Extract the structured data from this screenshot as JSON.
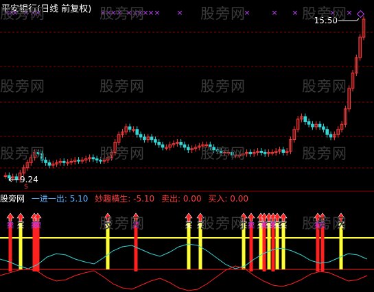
{
  "title": "平安银行(日线 前复权)",
  "watermark": "股旁网",
  "price_high_label": "15.50",
  "price_low_label": "9.24",
  "low_marker": "S",
  "indicator": {
    "panel_name": "股旁网",
    "name_one_label": "一进一出: 5.10",
    "name_two_label": "妙趣横生: -5.10",
    "sell_label": "卖出: 0.00",
    "buy_label": "买入: 0.00"
  },
  "signal_labels": {
    "buy": "买",
    "sell": "卖"
  },
  "colors": {
    "up": "#ff3b3b",
    "down": "#33d6d6",
    "grid": "#8b0000",
    "marker": "#c040ff",
    "signal_yellow": "#ffff33",
    "signal_red": "#ff2020",
    "cyan_line": "#33d6d6",
    "red_line": "#ff2020",
    "label_blue": "#5fb3ff",
    "label_red": "#ff4040"
  },
  "chart_data": {
    "type": "candlestick",
    "title": "平安银行(日线 前复权)",
    "y_high": 15.5,
    "y_low": 9.24,
    "closes": [
      9.4,
      9.3,
      9.35,
      9.24,
      9.5,
      9.7,
      9.9,
      10.1,
      10.3,
      10.25,
      10.0,
      9.9,
      9.8,
      9.85,
      9.9,
      9.95,
      9.9,
      9.92,
      9.95,
      10.0,
      9.98,
      10.0,
      10.05,
      10.1,
      10.05,
      10.0,
      9.98,
      10.0,
      10.1,
      10.3,
      10.7,
      11.0,
      11.1,
      11.3,
      11.2,
      11.2,
      11.0,
      10.9,
      10.8,
      10.9,
      10.8,
      10.7,
      10.6,
      10.5,
      10.5,
      10.6,
      10.65,
      10.7,
      10.6,
      10.5,
      10.4,
      10.45,
      10.5,
      10.55,
      10.6,
      10.6,
      10.5,
      10.4,
      10.35,
      10.3,
      10.3,
      10.3,
      10.2,
      10.2,
      10.2,
      10.25,
      10.3,
      10.25,
      10.3,
      10.35,
      10.3,
      10.25,
      10.3,
      10.3,
      10.35,
      10.4,
      10.3,
      10.35,
      10.8,
      11.2,
      11.6,
      11.7,
      11.5,
      11.4,
      11.3,
      11.4,
      11.3,
      11.2,
      11.0,
      10.9,
      11.0,
      11.2,
      11.4,
      12.0,
      12.8,
      13.4,
      14.0,
      14.8,
      15.5
    ],
    "sell_markers_count": 12,
    "indicator_signals": {
      "buy_labels_count": 8,
      "sell_labels_count": 5
    }
  }
}
